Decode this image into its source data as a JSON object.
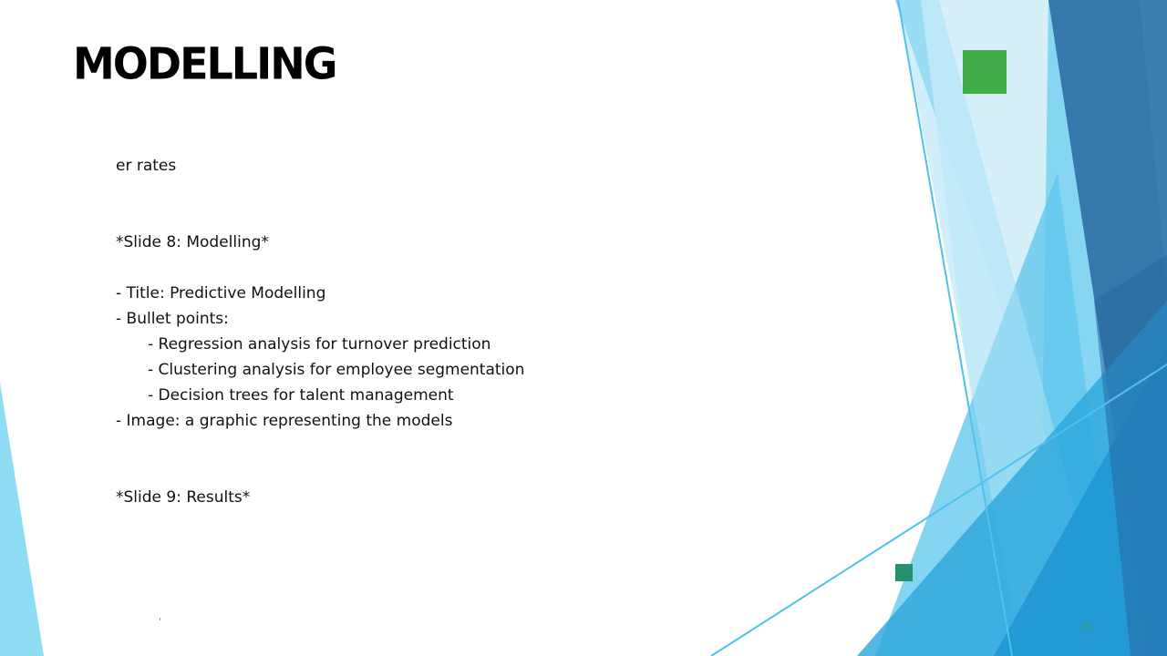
{
  "slide": {
    "title": "MODELLING",
    "lines": [
      "er rates",
      "*Slide 8: Modelling*",
      "- Title: Predictive Modelling",
      "- Bullet points:",
      "- Regression analysis for turnover prediction",
      "- Clustering analysis for employee segmentation",
      "- Decision trees for talent management",
      "- Image: a graphic representing the models",
      "*Slide 9: Results*"
    ],
    "slide_number": "10",
    "tiny_mark": "'"
  },
  "colors": {
    "accent_green": "#41ad49",
    "small_square_teal": "#25906e",
    "light_blue": "#7fd3f0",
    "mid_blue": "#3fb7e8",
    "dark_blue": "#2c6ea8",
    "deep_blue": "#1f9bd4",
    "slide_number_color": "#3aa04a"
  }
}
